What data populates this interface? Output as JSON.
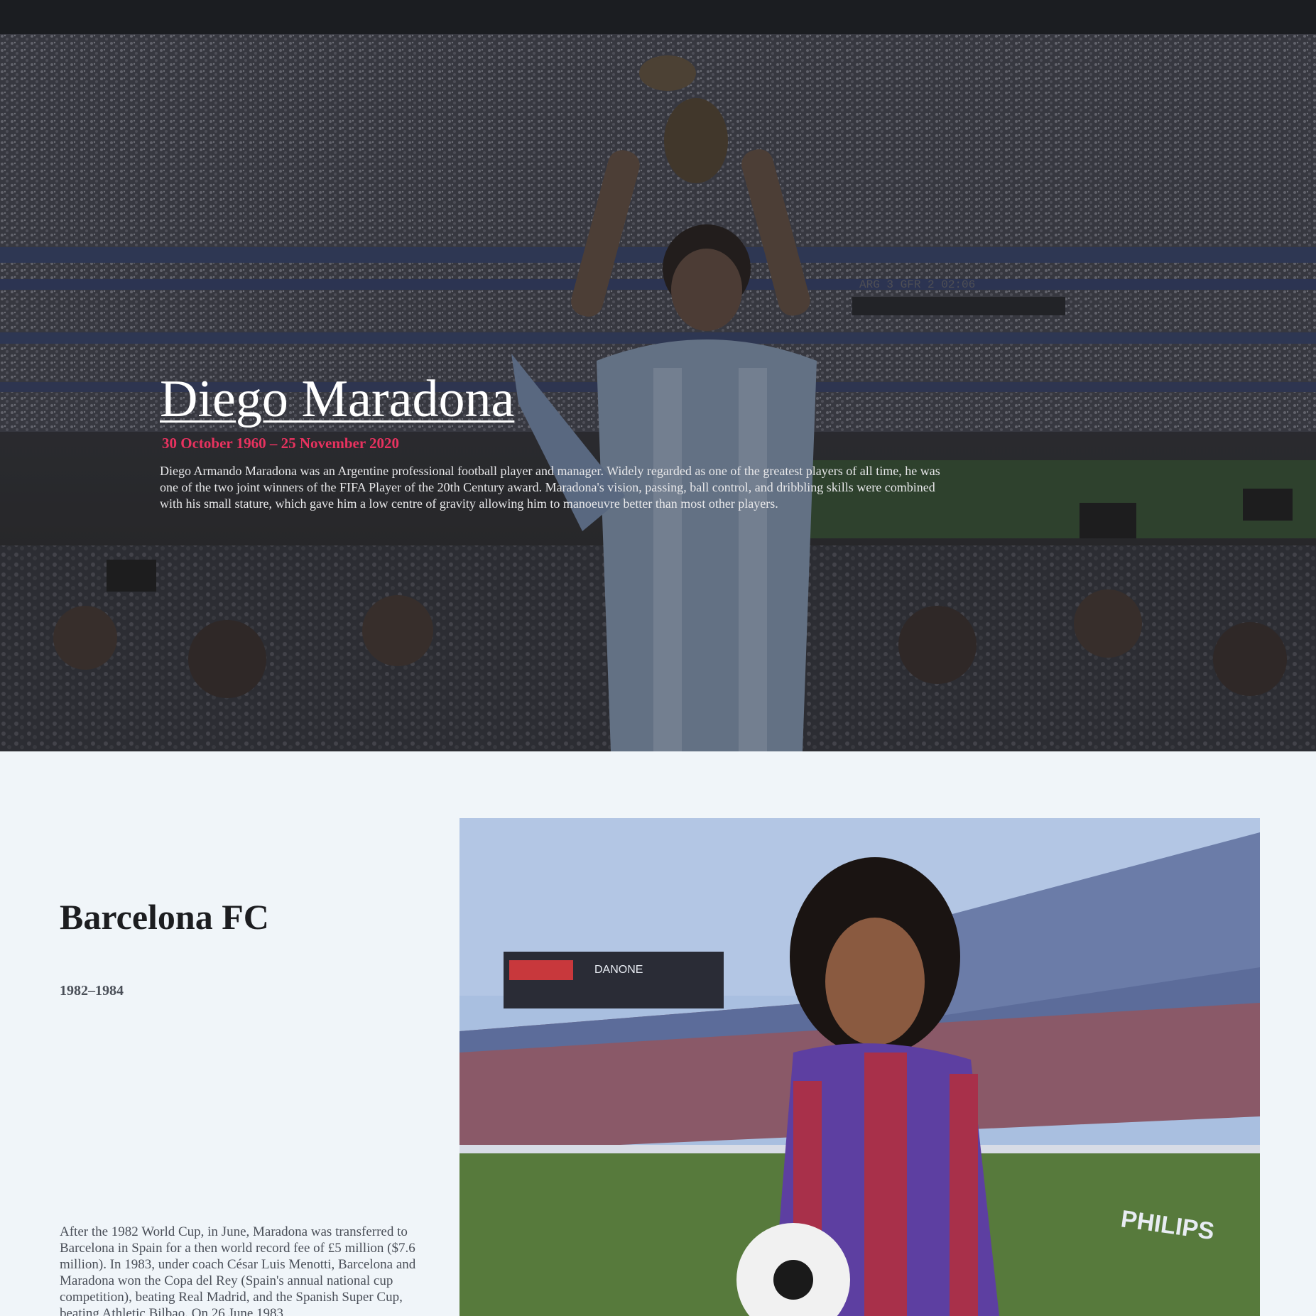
{
  "hero": {
    "title": "Diego Maradona",
    "dates": "30 October 1960 – 25 November 2020",
    "description": "Diego Armando Maradona was an Argentine professional football player and manager. Widely regarded as one of the greatest players of all time, he was one of the two joint winners of the FIFA Player of the 20th Century award. Maradona's vision, passing, ball control, and dribbling skills were combined with his small stature, which gave him a low centre of gravity allowing him to manoeuvre better than most other players.",
    "image_subject": "Maradona lifting the World Cup trophy in a crowded stadium",
    "scoreboard_text": "ARG 3 GFR 2 02:06"
  },
  "club": {
    "title": "Barcelona FC",
    "years": "1982–1984",
    "text": "After the 1982 World Cup, in June, Maradona was transferred to Barcelona in Spain for a then world record fee of £5 million ($7.6 million). In 1983, under coach César Luis Menotti, Barcelona and Maradona won the Copa del Rey (Spain's annual national cup competition), beating Real Madrid, and the Spanish Super Cup, beating Athletic Bilbao. On 26 June 1983",
    "image_subject": "Maradona in Barcelona kit holding a ball in an empty stadium",
    "stadium_ad_1": "DANONE",
    "stadium_ad_2": "PHILIPS"
  },
  "colors": {
    "topbar": "#1b1d21",
    "accent_dates": "#e8325f",
    "section_bg": "#f0f5f9"
  }
}
